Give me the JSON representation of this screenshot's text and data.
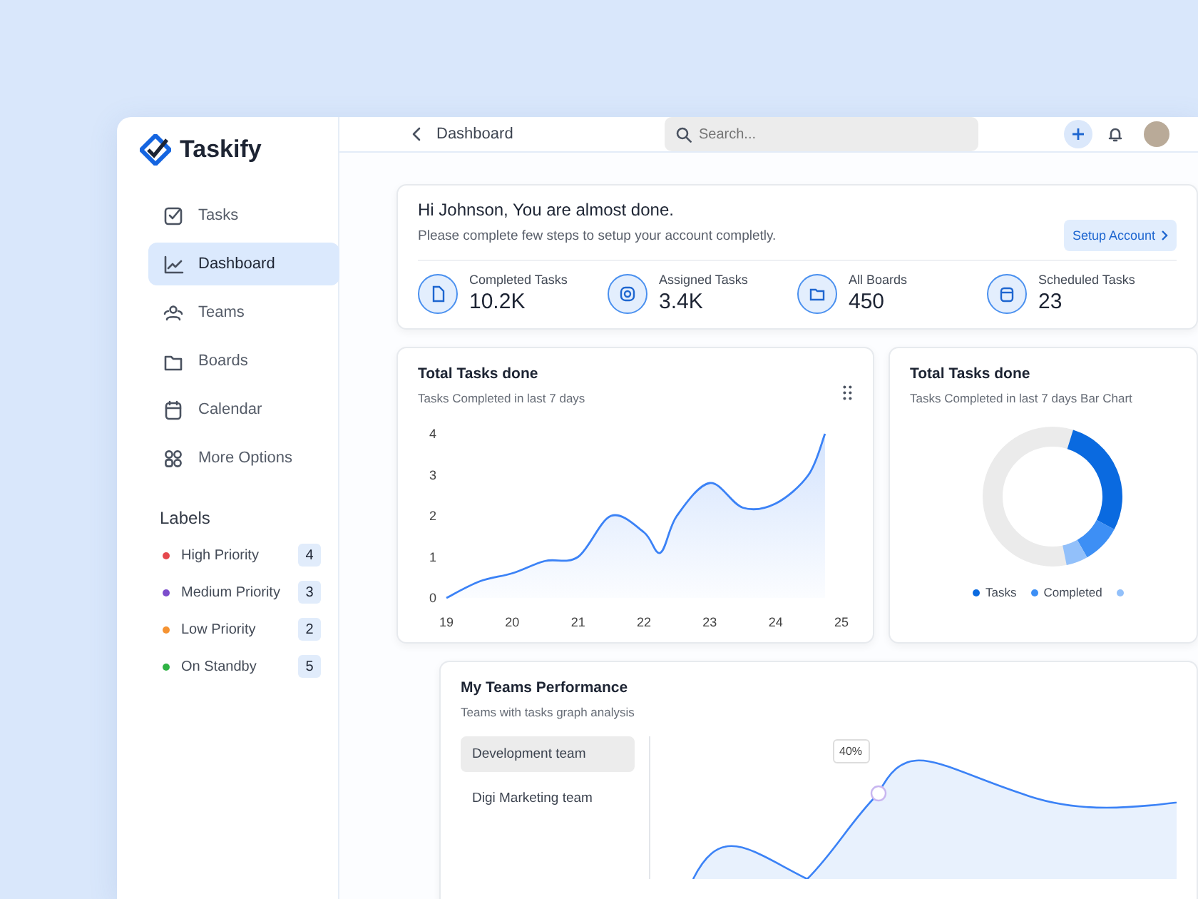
{
  "brand": {
    "name": "Taskify"
  },
  "sidebar": {
    "items": [
      {
        "label": "Tasks",
        "selected": false
      },
      {
        "label": "Dashboard",
        "selected": true
      },
      {
        "label": "Teams",
        "selected": false
      },
      {
        "label": "Boards",
        "selected": false
      },
      {
        "label": "Calendar",
        "selected": false
      },
      {
        "label": "More Options",
        "selected": false
      }
    ],
    "labels_title": "Labels",
    "labels": [
      {
        "name": "High Priority",
        "color": "#e5484d",
        "count": "4"
      },
      {
        "name": "Medium Priority",
        "color": "#7c4dcc",
        "count": "3"
      },
      {
        "name": "Low Priority",
        "color": "#f59332",
        "count": "2"
      },
      {
        "name": "On Standby",
        "color": "#2fb344",
        "count": "5"
      }
    ]
  },
  "header": {
    "title": "Dashboard",
    "search": {
      "placeholder": "Search..."
    }
  },
  "welcome": {
    "title": "Hi Johnson, You are almost done.",
    "subtitle": "Please complete few steps to setup your account completly.",
    "button": "Setup Account",
    "stats": [
      {
        "label": "Completed Tasks",
        "value": "10.2K"
      },
      {
        "label": "Assigned Tasks",
        "value": "3.4K"
      },
      {
        "label": "All Boards",
        "value": "450"
      },
      {
        "label": "Scheduled Tasks",
        "value": "23"
      }
    ]
  },
  "tasks_chart": {
    "title": "Total Tasks done",
    "subtitle": "Tasks Completed in last 7 days",
    "chart_data": {
      "type": "area",
      "x": [
        19,
        19.5,
        20,
        20.5,
        21,
        21.5,
        22,
        22.25,
        22.5,
        23,
        23.5,
        24,
        24.5,
        24.75
      ],
      "series": [
        {
          "color": "#3b82f6",
          "values": [
            0,
            0.4,
            0.6,
            0.9,
            1.0,
            2.0,
            1.6,
            1.1,
            2.0,
            2.8,
            2.2,
            2.3,
            3.0,
            4.0
          ]
        }
      ],
      "xlim": [
        19,
        25
      ],
      "ylim": [
        0,
        4
      ],
      "xticks": [
        19,
        20,
        21,
        22,
        23,
        24,
        25
      ],
      "yticks": [
        0,
        1,
        2,
        3,
        4
      ]
    }
  },
  "donut_card": {
    "title": "Total Tasks done",
    "subtitle": "Tasks Completed in last 7 days Bar Chart",
    "legend": [
      {
        "name": "Tasks",
        "color": "#0a6ae0"
      },
      {
        "name": "Completed",
        "color": "#3d8ff5"
      },
      {
        "color": "#92c0fa"
      }
    ]
  },
  "teams": {
    "title": "My Teams Performance",
    "subtitle": "Teams with tasks graph analysis",
    "items": [
      {
        "name": "Development team",
        "selected": true
      },
      {
        "name": "Digi Marketing team",
        "selected": false
      }
    ],
    "tooltip": "40%"
  }
}
